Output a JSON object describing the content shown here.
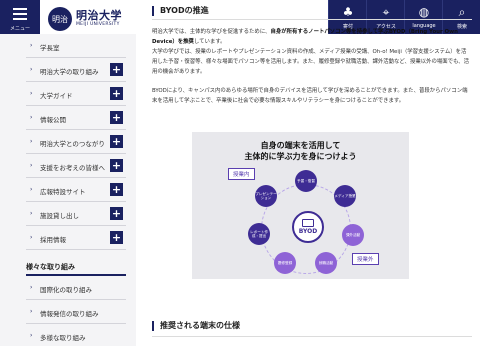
{
  "header": {
    "menu_label": "メニュー",
    "logo_mark": "明治",
    "logo_jp": "明治大学",
    "logo_en": "MEIJI UNIVERSITY",
    "nav": [
      {
        "label": "寄付",
        "icon": "sprout-icon",
        "glyph": "♣"
      },
      {
        "label": "アクセス",
        "icon": "pin-icon",
        "glyph": "⌖"
      },
      {
        "label": "language",
        "icon": "globe-icon",
        "glyph": "◍"
      },
      {
        "label": "検索",
        "icon": "search-icon",
        "glyph": "⌕"
      }
    ]
  },
  "sidebar": {
    "items": [
      {
        "label": "学長室",
        "has_plus": false
      },
      {
        "label": "明治大学の取り組み",
        "has_plus": true
      },
      {
        "label": "大学ガイド",
        "has_plus": true
      },
      {
        "label": "情報公開",
        "has_plus": true
      },
      {
        "label": "明治大学とのつながり",
        "has_plus": true
      },
      {
        "label": "支援をお考えの皆様へ",
        "has_plus": true
      },
      {
        "label": "広報特設サイト",
        "has_plus": true
      },
      {
        "label": "施設貸し出し",
        "has_plus": true
      },
      {
        "label": "採用情報",
        "has_plus": true
      }
    ],
    "section_title": "様々な取り組み",
    "sub_items": [
      {
        "label": "国際化の取り組み"
      },
      {
        "label": "情報発信の取り組み"
      },
      {
        "label": "多様な取り組み"
      }
    ]
  },
  "main": {
    "section1_title": "BYODの推進",
    "para1_a": "明治大学では、主体的な学びを促進するために、",
    "para1_b": "自身が所有するノートパソコン等を持参して学ぶBYOD（Bring Your Own Device）を推奨",
    "para1_c": "しています。",
    "para2": "大学の学びでは、授業のレポートやプレゼンテーション資料の作成、メディア授業の受講、Oh-o! Meiji（学習支援システム）を活用した予習・復習等、様々な場面でパソコン等を活用します。また、履修登録や就職活動、課外活動など、授業以外の場面でも、活用の機会があります。",
    "para3": "BYODにより、キャンパス内のあらゆる場所で自身のデバイスを活用して学びを深めることができます。また、普段からパソコン端末を活用して学ぶことで、卒業後に社会で必要な情報スキルやリテラシーを身につけることができます。",
    "section2_title": "推奨される端末の仕様"
  },
  "diagram": {
    "title_line1": "自身の端末を活用して",
    "title_line2": "主体的に学ぶ力を身につけよう",
    "tag_in_class": "授業内",
    "tag_out_class": "授業外",
    "center_label": "BYOD",
    "nodes": [
      {
        "label": "予習・復習",
        "color": "#3e2c94"
      },
      {
        "label": "メディア授業",
        "color": "#3e2c94"
      },
      {
        "label": "課外活動",
        "color": "#8e63d6"
      },
      {
        "label": "就職活動",
        "color": "#8e63d6"
      },
      {
        "label": "履修登録",
        "color": "#8e63d6"
      },
      {
        "label": "レポート作成・提出",
        "color": "#3e2c94"
      },
      {
        "label": "プレゼンテーション",
        "color": "#3e2c94"
      }
    ]
  }
}
